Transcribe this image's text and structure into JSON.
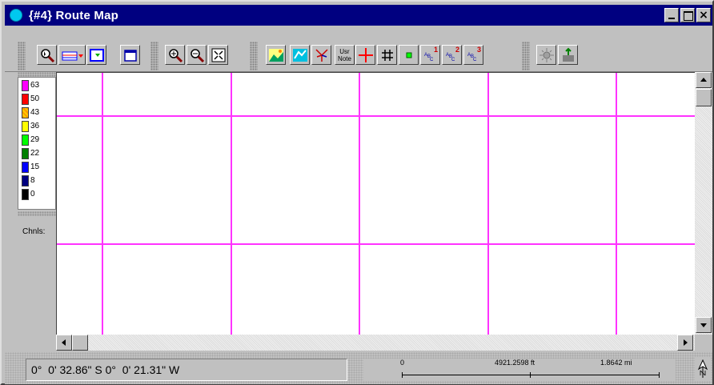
{
  "window": {
    "title": "{#4} Route Map",
    "controls": {
      "close_glyph": "×"
    }
  },
  "toolbar": {
    "tools": [
      {
        "name": "zoom-select-tool",
        "icon": "magnifier-pointer-icon"
      },
      {
        "name": "map-layer-dropdown",
        "icon": "map-layers-icon"
      },
      {
        "name": "map-view-tool",
        "icon": "map-frame-icon"
      },
      {
        "name": "blank-map-tool",
        "icon": "window-icon"
      },
      {
        "name": "zoom-in-2x-tool",
        "icon": "zoom-in-icon"
      },
      {
        "name": "zoom-out-2x-tool",
        "icon": "zoom-out-icon"
      },
      {
        "name": "zoom-fit-tool",
        "icon": "fit-extent-icon"
      },
      {
        "name": "terrain-tool",
        "icon": "landscape-icon"
      },
      {
        "name": "terrain-edit-tool",
        "icon": "terrain-icon"
      },
      {
        "name": "route-tool",
        "icon": "branch-icon"
      },
      {
        "name": "user-note-tool",
        "icon": "user-note-icon",
        "label": "Usr\nNote"
      },
      {
        "name": "crosshair-tool",
        "icon": "crosshair-icon"
      },
      {
        "name": "grid-tool",
        "icon": "grid-icon"
      },
      {
        "name": "marker-tool",
        "icon": "green-square-icon"
      },
      {
        "name": "label-set-1-tool",
        "icon": "abc-1-icon",
        "label": "1"
      },
      {
        "name": "label-set-2-tool",
        "icon": "abc-2-icon",
        "label": "2"
      },
      {
        "name": "label-set-3-tool",
        "icon": "abc-3-icon",
        "label": "3"
      },
      {
        "name": "sun-tool",
        "icon": "sun-icon"
      },
      {
        "name": "export-tool",
        "icon": "export-icon"
      }
    ]
  },
  "legend": {
    "items": [
      {
        "value": "63",
        "color": "#ff00ff"
      },
      {
        "value": "50",
        "color": "#ff0000"
      },
      {
        "value": "43",
        "color": "#ff9900"
      },
      {
        "value": "36",
        "color": "#ffff00"
      },
      {
        "value": "29",
        "color": "#00ff00"
      },
      {
        "value": "22",
        "color": "#008000"
      },
      {
        "value": "15",
        "color": "#0000ff"
      },
      {
        "value": "8",
        "color": "#000080"
      },
      {
        "value": "0",
        "color": "#000000"
      }
    ],
    "channels_label": "Chnls:"
  },
  "map": {
    "grid_color": "#ff33ff"
  },
  "status": {
    "coordinates": "0°  0' 32.86\" S 0°  0' 21.31\" W",
    "scale": {
      "zero": "0",
      "mid": "4921.2598 ft",
      "end": "1.8642 mi"
    },
    "north_icon": "north-arrow-icon"
  }
}
